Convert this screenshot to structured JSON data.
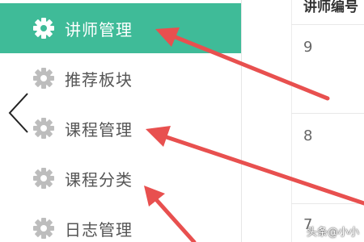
{
  "sidebar": {
    "items": [
      {
        "label": "讲师管理",
        "icon": "gear-icon",
        "active": true
      },
      {
        "label": "推荐板块",
        "icon": "gear-icon",
        "active": false
      },
      {
        "label": "课程管理",
        "icon": "gear-icon",
        "active": false
      },
      {
        "label": "课程分类",
        "icon": "gear-icon",
        "active": false
      },
      {
        "label": "日志管理",
        "icon": "gear-icon",
        "active": false
      }
    ],
    "back_icon": "chevron-left-icon"
  },
  "table": {
    "header": "讲师编号",
    "rows": [
      "9",
      "8",
      "7"
    ]
  },
  "watermark": "头条@小小",
  "colors": {
    "active_bg": "#3fbb98",
    "arrow": "#e8504f",
    "icon_inactive": "#bdbdbd",
    "icon_active": "#ffffff"
  }
}
